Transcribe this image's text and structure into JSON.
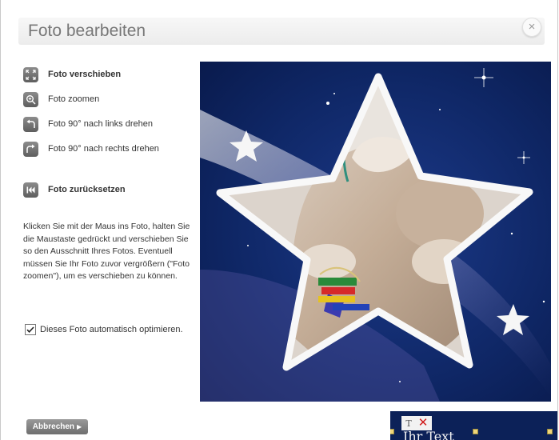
{
  "dialog": {
    "title": "Foto bearbeiten",
    "close_label": "×"
  },
  "tools": [
    {
      "label": "Foto verschieben",
      "icon": "move-icon",
      "bold": true
    },
    {
      "label": "Foto zoomen",
      "icon": "zoom-icon",
      "bold": false
    },
    {
      "label": "Foto 90° nach links drehen",
      "icon": "rotate-left-icon",
      "bold": false
    },
    {
      "label": "Foto 90° nach rechts drehen",
      "icon": "rotate-right-icon",
      "bold": false
    },
    {
      "label": "Foto zurücksetzen",
      "icon": "reset-icon",
      "bold": true
    }
  ],
  "help_text": "Klicken Sie mit der Maus ins Foto, halten Sie die Maustaste gedrückt und verschieben Sie so den Ausschnitt Ihres Fotos. Eventuell müssen Sie Ihr Foto zuvor vergrößern (\"Foto zoomen\"), um es verschieben zu können.",
  "auto_optimize": {
    "label": "Dieses Foto automatisch optimieren.",
    "checked": true
  },
  "cancel_button": "Abbrechen",
  "thumbnail": {
    "text": "Ihr Text",
    "text_tool_label": "T"
  },
  "colors": {
    "background_navy": "#0d2461",
    "icon_grey": "#6f6f6f",
    "delete_red": "#d01a1a"
  }
}
